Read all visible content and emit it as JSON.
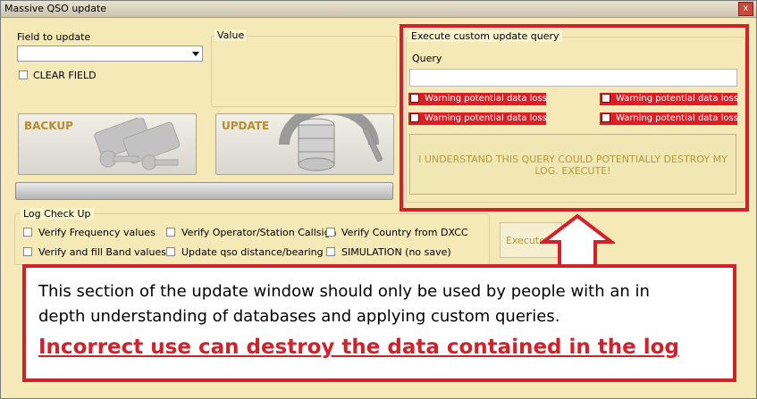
{
  "window": {
    "title": "Massive QSO update",
    "close_glyph": "x"
  },
  "field_to_update": {
    "label": "Field to update",
    "selected": "",
    "clear_label": "CLEAR FIELD"
  },
  "value_group": {
    "title": "Value"
  },
  "buttons": {
    "backup": "BACKUP",
    "update": "UPDATE"
  },
  "custom_query": {
    "group_title": "Execute custom update query",
    "query_label": "Query",
    "query_value": "",
    "warnings": [
      "Warning potential data loss",
      "Warning potential data loss",
      "Warning potential data loss",
      "Warning potential data loss"
    ],
    "execute_label": "I UNDERSTAND THIS QUERY COULD POTENTIALLY DESTROY MY LOG. EXECUTE!"
  },
  "log_check": {
    "title": "Log Check Up",
    "items": [
      "Verify Frequency values",
      "Verify Operator/Station Callsign",
      "Verify Country from DXCC",
      "Verify and fill Band values",
      "Update qso distance/bearing",
      "SIMULATION (no save)"
    ],
    "execute_label": "Execute ch"
  },
  "annotation": {
    "line1": "This section of the update window should only be used by people with an in",
    "line2": "depth understanding of databases and applying custom queries.",
    "warning": "Incorrect use can destroy the data contained in the log",
    "color": "#d3212b"
  }
}
